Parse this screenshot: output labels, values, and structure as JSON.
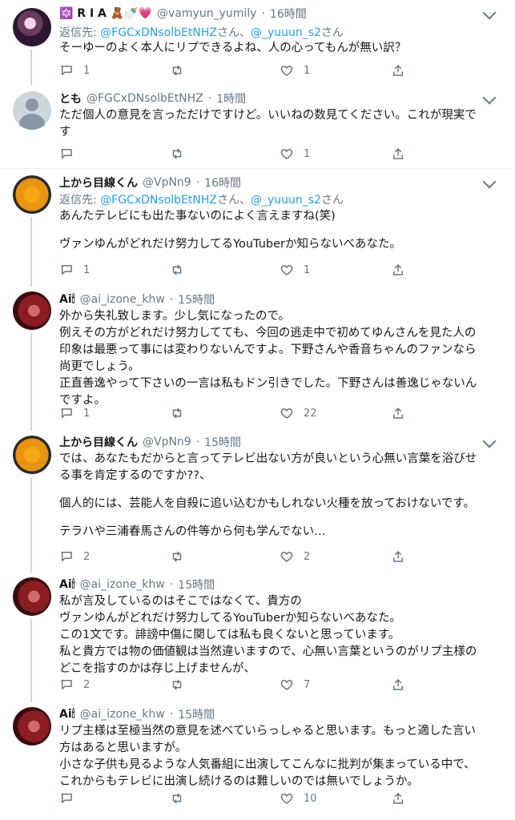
{
  "tweets": [
    {
      "name": "🔯 R I A 🧸🍼💗",
      "handle": "@vamyun_yumily",
      "time": "16時間",
      "reply_label": "返信先:",
      "reply_user1": "@FGCxDNsolbEtNHZ",
      "reply_joiner": "さん、",
      "reply_user2": "@_yuuun_s2",
      "reply_suffix": "さん",
      "lines": [
        "そーゆーのよく本人にリプできるよね、人の心ってもんが無い訳？"
      ],
      "replies": "1",
      "retweets": "",
      "likes": "1"
    },
    {
      "name": "とも",
      "handle": "@FGCxDNsolbEtNHZ",
      "time": "1時間",
      "lines": [
        "ただ個人の意見を言っただけですけど。いいねの数見てください。これが現実で",
        "す"
      ],
      "replies": "",
      "retweets": "",
      "likes": "1"
    },
    {
      "name": "上から目線くん",
      "handle": "@VpNn9",
      "time": "16時間",
      "reply_label": "返信先:",
      "reply_user1": "@FGCxDNsolbEtNHZ",
      "reply_joiner": "さん、",
      "reply_user2": "@_yuuun_s2",
      "reply_suffix": "さん",
      "lines": [
        "あんたテレビにも出た事ないのによく言えますね(笑)",
        "",
        "ヴァンゆんがどれだけ努力してるYouTuberか知らないべあなた。"
      ],
      "replies": "1",
      "retweets": "",
      "likes": "1"
    },
    {
      "name": "Ai🕯",
      "handle": "@ai_izone_khw",
      "time": "15時間",
      "lines": [
        "外から失礼致します。少し気になったので。",
        "例えその方がどれだけ努力してても、今回の逃走中で初めてゆんさんを見た人の",
        "印象は最悪って事には変わりないんですよ。下野さんや香音ちゃんのファンなら",
        "尚更でしょう。",
        "正直善逸やって下さいの一言は私もドン引きでした。下野さんは善逸じゃないん",
        "ですよ。"
      ],
      "replies": "1",
      "retweets": "",
      "likes": "22"
    },
    {
      "name": "上から目線くん",
      "handle": "@VpNn9",
      "time": "15時間",
      "lines": [
        "では、あなたもだからと言ってテレビ出ない方が良いという心無い言葉を浴びせ",
        "る事を肯定するのですか??、",
        "",
        "個人的には、芸能人を自殺に追い込むかもしれない火種を放っておけないです。",
        "",
        "テラハや三浦春馬さんの件等から何も学んでない…"
      ],
      "replies": "2",
      "retweets": "",
      "likes": "2"
    },
    {
      "name": "Ai🕯",
      "handle": "@ai_izone_khw",
      "time": "15時間",
      "lines": [
        "私が言及しているのはそこではなくて、貴方の",
        "ヴァンゆんがどれだけ努力してるYouTuberか知らないべあなた。",
        "この1文です。誹謗中傷に関しては私も良くないと思っています。",
        "私と貴方では物の価値観は当然違いますので、心無い言葉というのがリプ主様の",
        "どこを指すのかは存じ上げませんが、"
      ],
      "replies": "2",
      "retweets": "",
      "likes": "7"
    },
    {
      "name": "Ai🕯",
      "handle": "@ai_izone_khw",
      "time": "15時間",
      "lines": [
        "リプ主様は至極当然の意見を述べていらっしゃると思います。もっと適した言い",
        "方はあると思いますが。",
        "小さな子供も見るような人気番組に出演してこんなに批判が集まっている中で、",
        "これからもテレビに出演し続けるのは難しいのでは無いでしょうか。"
      ],
      "replies": "",
      "retweets": "",
      "likes": "10"
    }
  ]
}
